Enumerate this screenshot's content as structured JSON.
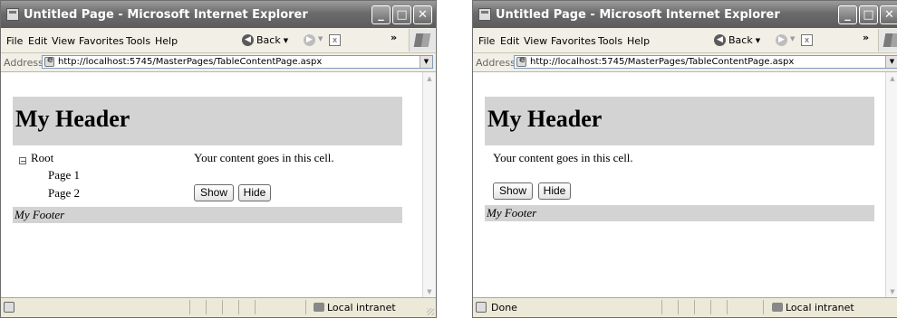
{
  "window_title": "Untitled Page - Microsoft Internet Explorer",
  "menu": [
    "File",
    "Edit",
    "View",
    "Favorites",
    "Tools",
    "Help"
  ],
  "back_label": "Back",
  "address_label": "Address",
  "address_url": "http://localhost:5745/MasterPages/TableContentPage.aspx",
  "page": {
    "header": "My Header",
    "tree": {
      "root": "Root",
      "children": [
        "Page 1",
        "Page 2"
      ]
    },
    "content_text": "Your content goes in this cell.",
    "show_label": "Show",
    "hide_label": "Hide",
    "footer": "My Footer"
  },
  "status": {
    "left_text": "",
    "right_text": "Done",
    "zone": "Local intranet"
  },
  "colors": {
    "header_bg": "#d3d3d3",
    "footer_bg": "#d3d3d3",
    "titlebar": "#6b6b6b"
  }
}
